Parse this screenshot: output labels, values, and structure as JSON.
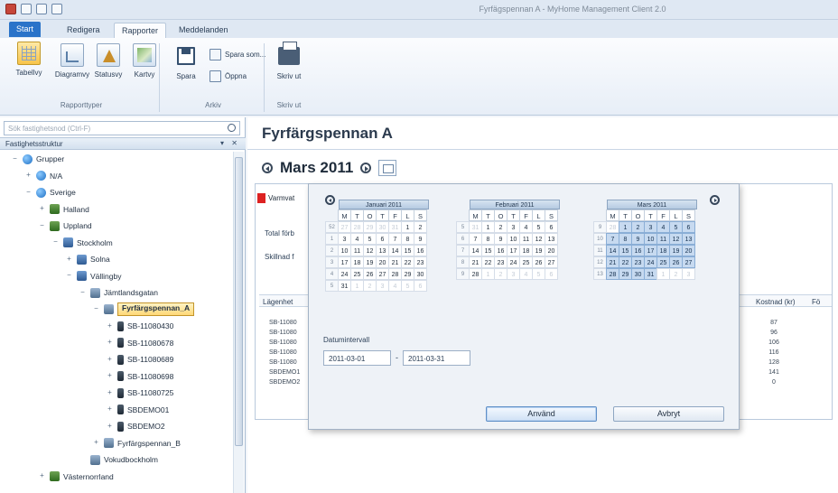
{
  "window": {
    "title": "Fyrfägspennan A - MyHome Management Client 2.0"
  },
  "ribbon": {
    "tabs": [
      "Start",
      "Redigera",
      "Rapporter",
      "Meddelanden"
    ],
    "active_tab": "Rapporter",
    "groups": {
      "rapporttyper": {
        "label": "Rapporttyper",
        "buttons": [
          "Tabellvy",
          "Diagramvy",
          "Statusvy",
          "Kartvy"
        ],
        "selected": "Tabellvy"
      },
      "arkiv": {
        "label": "Arkiv",
        "buttons": [
          "Spara",
          "Spara som...",
          "Öppna"
        ]
      },
      "skriv_ut": {
        "label": "Skriv ut",
        "buttons": [
          "Skriv ut"
        ]
      }
    }
  },
  "left": {
    "search_placeholder": "Sök fastighetsnod (Ctrl-F)",
    "pane_title": "Fastighetsstruktur",
    "pane_controls": "▾ ✕",
    "tree": [
      {
        "label": "Grupper",
        "level": 0,
        "exp": "−",
        "icon": "globe"
      },
      {
        "label": "N/A",
        "level": 1,
        "exp": "+",
        "icon": "globe"
      },
      {
        "label": "Sverige",
        "level": 1,
        "exp": "−",
        "icon": "globe"
      },
      {
        "label": "Halland",
        "level": 2,
        "exp": "+",
        "icon": "region"
      },
      {
        "label": "Uppland",
        "level": 2,
        "exp": "−",
        "icon": "region"
      },
      {
        "label": "Stockholm",
        "level": 3,
        "exp": "−",
        "icon": "city"
      },
      {
        "label": "Solna",
        "level": 4,
        "exp": "+",
        "icon": "city"
      },
      {
        "label": "Vällingby",
        "level": 4,
        "exp": "−",
        "icon": "city"
      },
      {
        "label": "Jämtlandsgatan",
        "level": 5,
        "exp": "−",
        "icon": "bld"
      },
      {
        "label": "Fyrfärgspennan_A",
        "level": 6,
        "exp": "−",
        "icon": "bld",
        "selected": true
      },
      {
        "label": "SB-11080430",
        "level": 7,
        "exp": "+",
        "icon": "dev"
      },
      {
        "label": "SB-11080678",
        "level": 7,
        "exp": "+",
        "icon": "dev"
      },
      {
        "label": "SB-11080689",
        "level": 7,
        "exp": "+",
        "icon": "dev"
      },
      {
        "label": "SB-11080698",
        "level": 7,
        "exp": "+",
        "icon": "dev"
      },
      {
        "label": "SB-11080725",
        "level": 7,
        "exp": "+",
        "icon": "dev"
      },
      {
        "label": "SBDEMO01",
        "level": 7,
        "exp": "+",
        "icon": "dev"
      },
      {
        "label": "SBDEMO2",
        "level": 7,
        "exp": "+",
        "icon": "dev"
      },
      {
        "label": "Fyrfärgspennan_B",
        "level": 6,
        "exp": "+",
        "icon": "bld"
      },
      {
        "label": "Vokudbockholm",
        "level": 5,
        "exp": "",
        "icon": "bld"
      },
      {
        "label": "Västernorrland",
        "level": 2,
        "exp": "+",
        "icon": "region"
      }
    ]
  },
  "main": {
    "title": "Fyrfärgspennan A",
    "month_label": "Mars 2011",
    "varmvatten_label": "Varmvat",
    "total_label": "Total förb",
    "skillnad_label": "Skillnad f",
    "col_lagenhet": "Lägenhet",
    "col_kostnad": "Kostnad (kr)",
    "col_fo": "Fö",
    "rows": [
      "SB-11080",
      "SB-11080",
      "SB-11080",
      "SB-11080",
      "SB-11080",
      "SBDEMO1",
      "SBDEMO2"
    ],
    "kostnad": [
      "87",
      "96",
      "106",
      "116",
      "128",
      "141",
      "0"
    ]
  },
  "dialog": {
    "dow": [
      "M",
      "T",
      "O",
      "T",
      "F",
      "L",
      "S"
    ],
    "months": [
      {
        "title": "Januari 2011",
        "weeks": [
          {
            "wn": "52",
            "days": [
              [
                "27",
                "o"
              ],
              [
                "28",
                "o"
              ],
              [
                "29",
                "o"
              ],
              [
                "30",
                "o"
              ],
              [
                "31",
                "o"
              ],
              [
                "1",
                ""
              ],
              [
                "2",
                ""
              ]
            ]
          },
          {
            "wn": "1",
            "days": [
              [
                "3",
                ""
              ],
              [
                "4",
                ""
              ],
              [
                "5",
                ""
              ],
              [
                "6",
                ""
              ],
              [
                "7",
                ""
              ],
              [
                "8",
                ""
              ],
              [
                "9",
                ""
              ]
            ]
          },
          {
            "wn": "2",
            "days": [
              [
                "10",
                ""
              ],
              [
                "11",
                ""
              ],
              [
                "12",
                ""
              ],
              [
                "13",
                ""
              ],
              [
                "14",
                ""
              ],
              [
                "15",
                ""
              ],
              [
                "16",
                ""
              ]
            ]
          },
          {
            "wn": "3",
            "days": [
              [
                "17",
                ""
              ],
              [
                "18",
                ""
              ],
              [
                "19",
                ""
              ],
              [
                "20",
                ""
              ],
              [
                "21",
                ""
              ],
              [
                "22",
                ""
              ],
              [
                "23",
                ""
              ]
            ]
          },
          {
            "wn": "4",
            "days": [
              [
                "24",
                ""
              ],
              [
                "25",
                ""
              ],
              [
                "26",
                ""
              ],
              [
                "27",
                ""
              ],
              [
                "28",
                ""
              ],
              [
                "29",
                ""
              ],
              [
                "30",
                ""
              ]
            ]
          },
          {
            "wn": "5",
            "days": [
              [
                "31",
                ""
              ],
              [
                "1",
                "o"
              ],
              [
                "2",
                "o"
              ],
              [
                "3",
                "o"
              ],
              [
                "4",
                "o"
              ],
              [
                "5",
                "o"
              ],
              [
                "6",
                "o"
              ]
            ]
          }
        ]
      },
      {
        "title": "Februari 2011",
        "weeks": [
          {
            "wn": "5",
            "days": [
              [
                "31",
                "o"
              ],
              [
                "1",
                ""
              ],
              [
                "2",
                ""
              ],
              [
                "3",
                ""
              ],
              [
                "4",
                ""
              ],
              [
                "5",
                ""
              ],
              [
                "6",
                ""
              ]
            ]
          },
          {
            "wn": "6",
            "days": [
              [
                "7",
                ""
              ],
              [
                "8",
                ""
              ],
              [
                "9",
                ""
              ],
              [
                "10",
                ""
              ],
              [
                "11",
                ""
              ],
              [
                "12",
                ""
              ],
              [
                "13",
                ""
              ]
            ]
          },
          {
            "wn": "7",
            "days": [
              [
                "14",
                ""
              ],
              [
                "15",
                ""
              ],
              [
                "16",
                ""
              ],
              [
                "17",
                ""
              ],
              [
                "18",
                ""
              ],
              [
                "19",
                ""
              ],
              [
                "20",
                ""
              ]
            ]
          },
          {
            "wn": "8",
            "days": [
              [
                "21",
                ""
              ],
              [
                "22",
                ""
              ],
              [
                "23",
                ""
              ],
              [
                "24",
                ""
              ],
              [
                "25",
                ""
              ],
              [
                "26",
                ""
              ],
              [
                "27",
                ""
              ]
            ]
          },
          {
            "wn": "9",
            "days": [
              [
                "28",
                ""
              ],
              [
                "1",
                "o"
              ],
              [
                "2",
                "o"
              ],
              [
                "3",
                "o"
              ],
              [
                "4",
                "o"
              ],
              [
                "5",
                "o"
              ],
              [
                "6",
                "o"
              ]
            ]
          }
        ]
      },
      {
        "title": "Mars 2011",
        "weeks": [
          {
            "wn": "9",
            "days": [
              [
                "28",
                "o"
              ],
              [
                "1",
                "s"
              ],
              [
                "2",
                "s"
              ],
              [
                "3",
                "s"
              ],
              [
                "4",
                "s"
              ],
              [
                "5",
                "s"
              ],
              [
                "6",
                "s"
              ]
            ]
          },
          {
            "wn": "10",
            "days": [
              [
                "7",
                "s"
              ],
              [
                "8",
                "s"
              ],
              [
                "9",
                "s"
              ],
              [
                "10",
                "s"
              ],
              [
                "11",
                "s"
              ],
              [
                "12",
                "s"
              ],
              [
                "13",
                "s"
              ]
            ]
          },
          {
            "wn": "11",
            "days": [
              [
                "14",
                "s"
              ],
              [
                "15",
                "s"
              ],
              [
                "16",
                "s"
              ],
              [
                "17",
                "s"
              ],
              [
                "18",
                "s"
              ],
              [
                "19",
                "s"
              ],
              [
                "20",
                "s"
              ]
            ]
          },
          {
            "wn": "12",
            "days": [
              [
                "21",
                "s"
              ],
              [
                "22",
                "s"
              ],
              [
                "23",
                "s"
              ],
              [
                "24",
                "s"
              ],
              [
                "25",
                "s"
              ],
              [
                "26",
                "s"
              ],
              [
                "27",
                "s"
              ]
            ]
          },
          {
            "wn": "13",
            "days": [
              [
                "28",
                "s"
              ],
              [
                "29",
                "s"
              ],
              [
                "30",
                "s"
              ],
              [
                "31",
                "s"
              ],
              [
                "1",
                "o"
              ],
              [
                "2",
                "o"
              ],
              [
                "3",
                "o"
              ]
            ]
          }
        ]
      }
    ],
    "interval_label": "Datumintervall",
    "from_date": "2011-03-01",
    "to_date": "2011-03-31",
    "dash": "-",
    "apply_label": "Använd",
    "cancel_label": "Avbryt"
  }
}
